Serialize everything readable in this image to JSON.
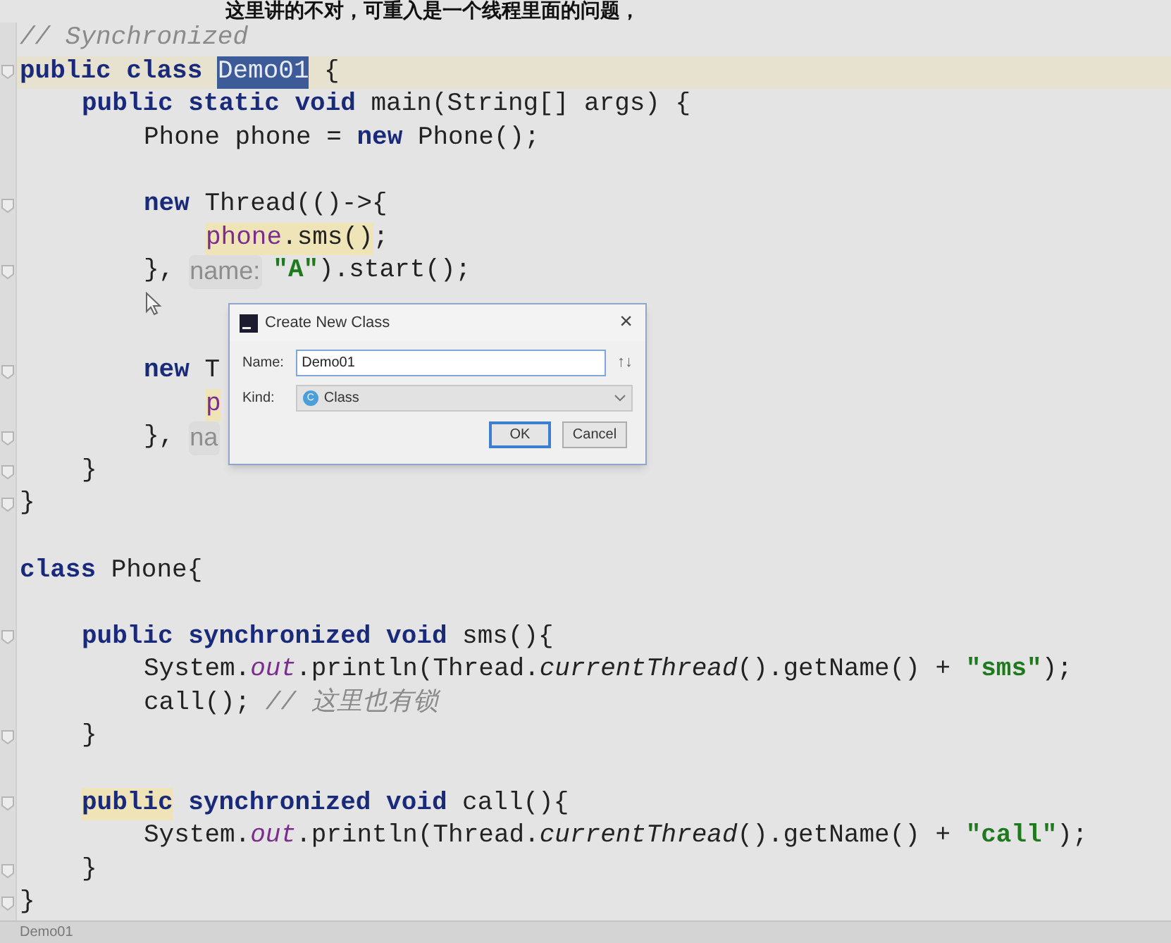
{
  "subtitle": "这里讲的不对，可重入是一个线程里面的问题，",
  "lines": [
    {
      "kind": "code",
      "tokens": [
        {
          "t": "// Synchronized",
          "kind": "comment"
        }
      ]
    },
    {
      "kind": "code",
      "current": true,
      "fold": true,
      "tokens": [
        {
          "t": "public class ",
          "kind": "kw"
        },
        {
          "t": "Demo01",
          "kind": "selected"
        },
        {
          "t": " {",
          "kind": "plain"
        }
      ],
      "children": [
        {
          "kind": "code",
          "tokens": [
            {
              "t": "public static void ",
              "kind": "kw"
            },
            {
              "t": "main(String[] args) {",
              "kind": "plain"
            }
          ],
          "children": [
            {
              "kind": "code",
              "tokens": [
                {
                  "t": "Phone phone = ",
                  "kind": "plain"
                },
                {
                  "t": "new ",
                  "kind": "kw"
                },
                {
                  "t": "Phone();",
                  "kind": "plain"
                }
              ]
            },
            {
              "kind": "blank"
            },
            {
              "kind": "code",
              "fold": true,
              "tokens": [
                {
                  "t": "new ",
                  "kind": "kw"
                },
                {
                  "t": "Thread(()->{",
                  "kind": "plain"
                }
              ],
              "children": [
                {
                  "kind": "code",
                  "tokens": [
                    {
                      "t": "phone",
                      "kind": "field_hl"
                    },
                    {
                      "t": ".sms()",
                      "kind": "hl"
                    },
                    {
                      "t": ";",
                      "kind": "plain"
                    }
                  ]
                }
              ]
            },
            {
              "kind": "code",
              "fold": true,
              "tokens": [
                {
                  "t": "},",
                  "kind": "plain"
                },
                {
                  "t": "name:",
                  "kind": "hint"
                },
                {
                  "t": "\"A\"",
                  "kind": "string"
                },
                {
                  "t": ").start();",
                  "kind": "plain"
                }
              ]
            },
            {
              "kind": "blank"
            },
            {
              "kind": "blank"
            },
            {
              "kind": "code",
              "fold": true,
              "tokens": [
                {
                  "t": "new ",
                  "kind": "kw"
                },
                {
                  "t": "T",
                  "kind": "plain"
                }
              ],
              "children": [
                {
                  "kind": "code",
                  "tokens": [
                    {
                      "t": "p",
                      "kind": "field_hl"
                    }
                  ]
                }
              ]
            },
            {
              "kind": "code",
              "fold": true,
              "tokens": [
                {
                  "t": "},",
                  "kind": "plain"
                },
                {
                  "t": "na",
                  "kind": "hint"
                }
              ]
            }
          ]
        },
        {
          "kind": "code",
          "fold": true,
          "tokens": [
            {
              "t": "}",
              "kind": "plain"
            }
          ]
        }
      ]
    },
    {
      "kind": "code",
      "fold": true,
      "tokens": [
        {
          "t": "}",
          "kind": "plain"
        }
      ]
    },
    {
      "kind": "blank"
    },
    {
      "kind": "code",
      "tokens": [
        {
          "t": "class ",
          "kind": "kw"
        },
        {
          "t": "Phone{",
          "kind": "plain"
        }
      ],
      "children": [
        {
          "kind": "blank"
        },
        {
          "kind": "code",
          "fold": true,
          "tokens": [
            {
              "t": "public synchronized void ",
              "kind": "kw"
            },
            {
              "t": "sms(){",
              "kind": "plain"
            }
          ],
          "children": [
            {
              "kind": "code",
              "tokens": [
                {
                  "t": "System.",
                  "kind": "plain"
                },
                {
                  "t": "out",
                  "kind": "static"
                },
                {
                  "t": ".println(Thread.",
                  "kind": "plain"
                },
                {
                  "t": "currentThread",
                  "kind": "italic"
                },
                {
                  "t": "().getName() + ",
                  "kind": "plain"
                },
                {
                  "t": "\"sms\"",
                  "kind": "string"
                },
                {
                  "t": ");",
                  "kind": "plain"
                }
              ]
            },
            {
              "kind": "code",
              "tokens": [
                {
                  "t": "call(); ",
                  "kind": "plain"
                },
                {
                  "t": "// 这里也有锁",
                  "kind": "comment"
                }
              ]
            }
          ]
        },
        {
          "kind": "code",
          "fold": true,
          "tokens": [
            {
              "t": "}",
              "kind": "plain"
            }
          ]
        },
        {
          "kind": "blank"
        },
        {
          "kind": "code",
          "fold": true,
          "tokens": [
            {
              "t": "public",
              "kind": "kw_hl"
            },
            {
              "t": " synchronized void ",
              "kind": "kw"
            },
            {
              "t": "call(){",
              "kind": "plain"
            }
          ],
          "children": [
            {
              "kind": "code",
              "tokens": [
                {
                  "t": "System.",
                  "kind": "plain"
                },
                {
                  "t": "out",
                  "kind": "static"
                },
                {
                  "t": ".println(Thread.",
                  "kind": "plain"
                },
                {
                  "t": "currentThread",
                  "kind": "italic"
                },
                {
                  "t": "().getName() + ",
                  "kind": "plain"
                },
                {
                  "t": "\"call\"",
                  "kind": "string"
                },
                {
                  "t": ");",
                  "kind": "plain"
                }
              ]
            }
          ]
        },
        {
          "kind": "code",
          "fold": true,
          "tokens": [
            {
              "t": "}",
              "kind": "plain"
            }
          ]
        }
      ]
    },
    {
      "kind": "code",
      "fold": true,
      "tokens": [
        {
          "t": "}",
          "kind": "plain"
        }
      ]
    }
  ],
  "dialog": {
    "title": "Create New Class",
    "close": "×",
    "name_label": "Name:",
    "name_value": "Demo01",
    "sort": "↑↓",
    "kind_label": "Kind:",
    "kind_badge": "C",
    "kind_value": "Class",
    "ok": "OK",
    "cancel": "Cancel"
  },
  "status_bar": {
    "text": "Demo01"
  }
}
